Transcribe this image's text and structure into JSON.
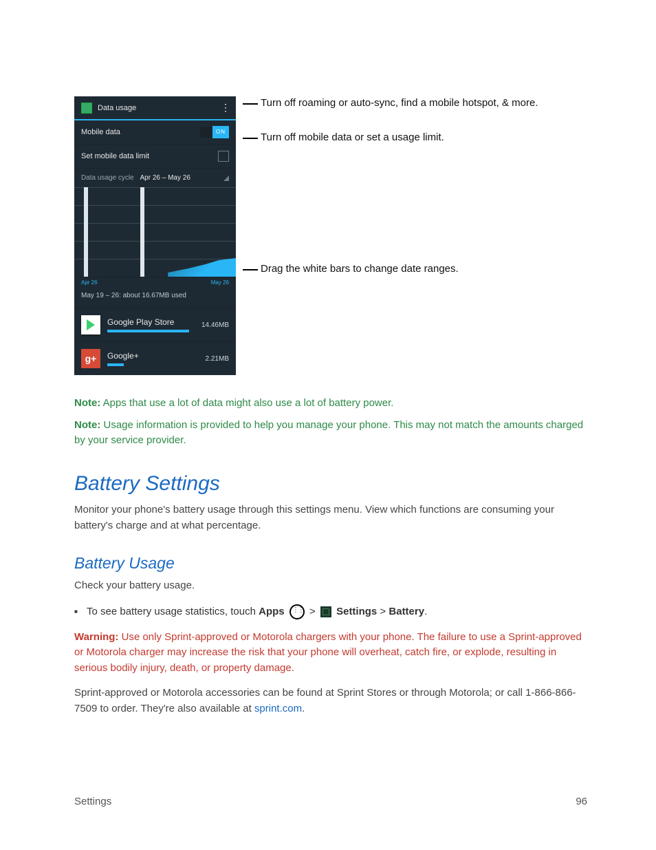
{
  "phone": {
    "title": "Data usage",
    "row_mobile_data": "Mobile data",
    "toggle_label": "ON",
    "row_set_limit": "Set mobile data limit",
    "cycle_label": "Data usage cycle",
    "cycle_range": "Apr 26 – May 26",
    "axis_start": "Apr 26",
    "axis_end": "May 26",
    "range_text": "May 19 – 26: about 16.67MB used",
    "apps": [
      {
        "name": "Google Play Store",
        "size": "14.46MB",
        "bar_pct": 92
      },
      {
        "name": "Google+",
        "size": "2.21MB",
        "bar_pct": 18
      }
    ]
  },
  "callouts": {
    "c1": "Turn off roaming or auto-sync, find a mobile hotspot, & more.",
    "c2": "Turn off mobile data or set a usage limit.",
    "c3": "Drag the white bars to change date ranges."
  },
  "notes": {
    "label": "Note:",
    "n1": "Apps that use a lot of data might also use a lot of battery power.",
    "n2": "Usage information is provided to help you manage your phone. This may not match the amounts charged by your service provider."
  },
  "section": {
    "title": "Battery Settings",
    "intro": "Monitor your phone's battery usage through this settings menu. View which functions are consuming your battery's charge and at what percentage."
  },
  "subsection": {
    "title": "Battery Usage",
    "intro": "Check your battery usage.",
    "step_prefix": "To see battery usage statistics, touch ",
    "apps_word": "Apps",
    "gt": ">",
    "settings_word": "Settings",
    "battery_word": "Battery",
    "period": "."
  },
  "warning": {
    "label": "Warning:",
    "text": "Use only Sprint-approved or Motorola chargers with your phone. The failure to use a Sprint-approved or Motorola charger may increase the risk that your phone will overheat, catch fire, or explode, resulting in serious bodily injury, death, or property damage."
  },
  "closing": {
    "text_a": "Sprint-approved or Motorola accessories can be found at Sprint Stores or through Motorola; or call 1-866-866-7509 to order. They're also available at ",
    "link": "sprint.com",
    "text_b": "."
  },
  "footer": {
    "left": "Settings",
    "right": "96"
  }
}
